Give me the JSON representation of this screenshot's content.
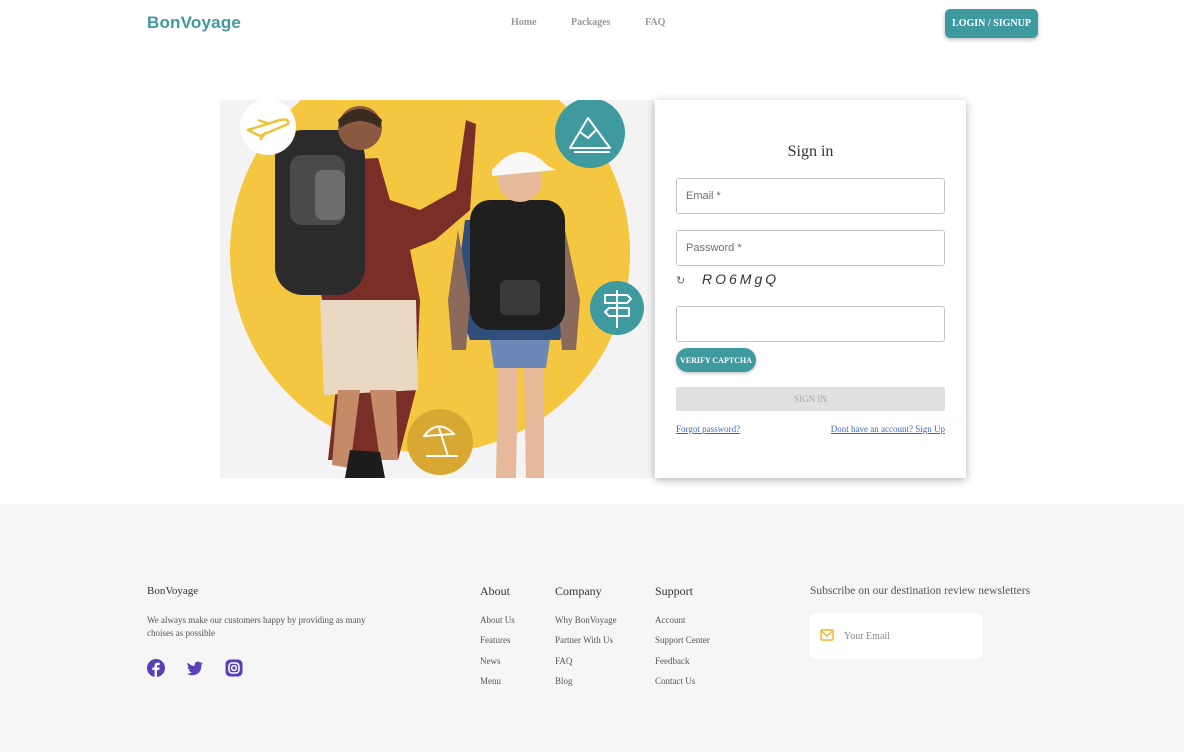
{
  "header": {
    "logo": "BonVoyage",
    "nav": [
      "Home",
      "Packages",
      "FAQ"
    ],
    "login_label": "LOGIN / SIGNUP"
  },
  "colors": {
    "accent": "#3f9aa0",
    "sun": "#f5c640",
    "link": "#3b68c4",
    "social": "#5a3fb8"
  },
  "hero": {
    "icons": [
      "airplane-icon",
      "mountain-icon",
      "signpost-icon",
      "beach-umbrella-icon"
    ]
  },
  "signin": {
    "title": "Sign in",
    "email_placeholder": "Email *",
    "password_placeholder": "Password *",
    "refresh_glyph": "↻",
    "captcha": "RO6MgQ",
    "captcha_input_value": "",
    "verify_label": "VERIFY CAPTCHA",
    "submit_label": "SIGN IN",
    "forgot_label": "Forgot password?",
    "signup_label": "Dont have an account? Sign Up"
  },
  "footer": {
    "brand": "BonVoyage",
    "description": "We always make our customers happy by providing as many choises as possible",
    "social": [
      "facebook-icon",
      "twitter-icon",
      "instagram-icon"
    ],
    "about": {
      "title": "About",
      "items": [
        "About Us",
        "Features",
        "News",
        "Menu"
      ]
    },
    "company": {
      "title": "Company",
      "items": [
        "Why BonVoyage",
        "Partner With Us",
        "FAQ",
        "Blog"
      ]
    },
    "support": {
      "title": "Support",
      "items": [
        "Account",
        "Support Center",
        "Feedback",
        "Contact Us"
      ]
    },
    "subscribe": {
      "title": "Subscribe on our destination review newsletters",
      "placeholder": "Your Email"
    }
  }
}
